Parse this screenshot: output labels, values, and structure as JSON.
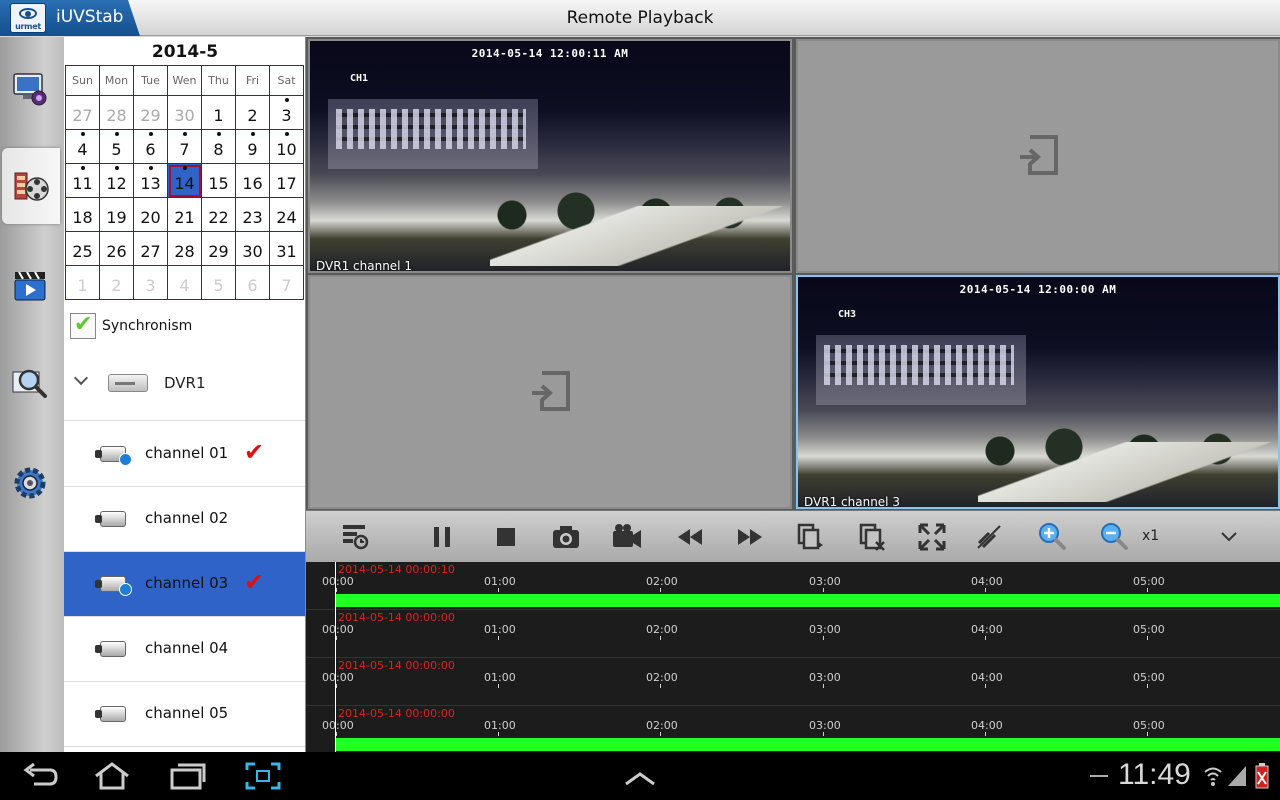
{
  "app": {
    "name": "iUVStab",
    "logo_word": "urmet",
    "title": "Remote Playback"
  },
  "toolbar": {
    "items": [
      {
        "name": "live-view",
        "icon": "monitor-camera-icon",
        "active": false
      },
      {
        "name": "playback",
        "icon": "film-reel-icon",
        "active": true
      },
      {
        "name": "local-playback",
        "icon": "clapper-icon",
        "active": false
      },
      {
        "name": "search",
        "icon": "magnifier-icon",
        "active": false
      },
      {
        "name": "settings",
        "icon": "gear-icon",
        "active": false
      }
    ]
  },
  "calendar": {
    "title": "2014-5",
    "weekdays": [
      "Sun",
      "Mon",
      "Tue",
      "Wen",
      "Thu",
      "Fri",
      "Sat"
    ],
    "selected": "14",
    "weeks": [
      [
        {
          "d": "27",
          "t": "muted"
        },
        {
          "d": "28",
          "t": "muted"
        },
        {
          "d": "29",
          "t": "muted"
        },
        {
          "d": "30",
          "t": "muted"
        },
        {
          "d": "1"
        },
        {
          "d": "2"
        },
        {
          "d": "3",
          "dot": true
        }
      ],
      [
        {
          "d": "4",
          "dot": true
        },
        {
          "d": "5",
          "dot": true
        },
        {
          "d": "6",
          "dot": true
        },
        {
          "d": "7",
          "dot": true
        },
        {
          "d": "8",
          "dot": true
        },
        {
          "d": "9",
          "dot": true
        },
        {
          "d": "10",
          "dot": true
        }
      ],
      [
        {
          "d": "11",
          "dot": true
        },
        {
          "d": "12",
          "dot": true
        },
        {
          "d": "13",
          "dot": true
        },
        {
          "d": "14",
          "dot": true,
          "sel": true
        },
        {
          "d": "15"
        },
        {
          "d": "16"
        },
        {
          "d": "17"
        }
      ],
      [
        {
          "d": "18"
        },
        {
          "d": "19"
        },
        {
          "d": "20"
        },
        {
          "d": "21"
        },
        {
          "d": "22"
        },
        {
          "d": "23"
        },
        {
          "d": "24"
        }
      ],
      [
        {
          "d": "25"
        },
        {
          "d": "26"
        },
        {
          "d": "27"
        },
        {
          "d": "28"
        },
        {
          "d": "29"
        },
        {
          "d": "30"
        },
        {
          "d": "31"
        }
      ],
      [
        {
          "d": "1",
          "t": "next"
        },
        {
          "d": "2",
          "t": "next"
        },
        {
          "d": "3",
          "t": "next"
        },
        {
          "d": "4",
          "t": "next"
        },
        {
          "d": "5",
          "t": "next"
        },
        {
          "d": "6",
          "t": "next"
        },
        {
          "d": "7",
          "t": "next"
        }
      ]
    ]
  },
  "sync": {
    "label": "Synchronism",
    "checked": true
  },
  "device": {
    "label": "DVR1"
  },
  "channels": [
    {
      "label": "channel 01",
      "checked": true,
      "playing": true,
      "active": false
    },
    {
      "label": "channel 02",
      "checked": false,
      "playing": false,
      "active": false
    },
    {
      "label": "channel 03",
      "checked": true,
      "playing": true,
      "active": true
    },
    {
      "label": "channel 04",
      "checked": false,
      "playing": false,
      "active": false
    },
    {
      "label": "channel 05",
      "checked": false,
      "playing": false,
      "active": false
    }
  ],
  "check_mark": "✔",
  "tiles": [
    {
      "osd_time": "2014-05-14 12:00:11 AM",
      "osd_ch": "CH1",
      "label": "DVR1 channel 1",
      "video": true,
      "selected": false
    },
    {
      "video": false,
      "selected": false
    },
    {
      "video": false,
      "selected": false
    },
    {
      "osd_time": "2014-05-14 12:00:00 AM",
      "osd_ch": "CH3",
      "label": "DVR1 channel 3",
      "video": true,
      "selected": true
    }
  ],
  "controls": {
    "buttons": [
      "record-list-icon",
      "pause-icon",
      "stop-icon",
      "snapshot-icon",
      "record-icon",
      "rewind-icon",
      "fast-forward-icon",
      "copy-icon",
      "close-all-icon",
      "fullscreen-icon",
      "mute-icon",
      "zoom-in-icon",
      "zoom-out-icon"
    ],
    "speed": "x1"
  },
  "timeline": {
    "hours": [
      "00:00",
      "01:00",
      "02:00",
      "03:00",
      "04:00",
      "05:00"
    ],
    "tracks": [
      {
        "stamp": "2014-05-14 00:00:10",
        "recorded": true
      },
      {
        "stamp": "2014-05-14 00:00:00",
        "recorded": false
      },
      {
        "stamp": "2014-05-14 00:00:00",
        "recorded": false
      },
      {
        "stamp": "2014-05-14 00:00:00",
        "recorded": true
      }
    ]
  },
  "system": {
    "time": "11:49"
  },
  "colors": {
    "accent": "#2f63c8",
    "record_bar": "#22ff22",
    "timestamp": "#e02020",
    "tick": "#e01010"
  }
}
